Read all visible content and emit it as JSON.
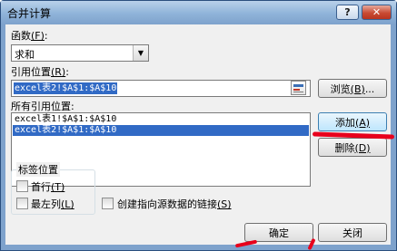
{
  "window": {
    "title": "合并计算",
    "help_glyph": "?",
    "close_glyph": "✕"
  },
  "function": {
    "label": "函数",
    "hotkey": "(F)",
    "suffix": ":",
    "value": "求和"
  },
  "reference": {
    "label": "引用位置",
    "hotkey": "(R)",
    "suffix": ":",
    "value": "excel表2!$A$1:$A$10",
    "browse_label": "浏览",
    "browse_hotkey": "(B)",
    "browse_suffix": "..."
  },
  "all_references": {
    "label": "所有引用位置",
    "suffix": ":",
    "items": [
      "excel表1!$A$1:$A$10",
      "excel表2!$A$1:$A$10"
    ],
    "selected_index": 1
  },
  "buttons": {
    "add_label": "添加",
    "add_hotkey": "(A)",
    "delete_label": "删除",
    "delete_hotkey": "(D)",
    "ok_label": "确定",
    "close_label": "关闭"
  },
  "label_position": {
    "title": "标签位置",
    "top_row_label": "首行",
    "top_row_hotkey": "(T)",
    "left_column_label": "最左列",
    "left_column_hotkey": "(L)"
  },
  "link": {
    "label": "创建指向源数据的链接",
    "hotkey": "(S)"
  },
  "colors": {
    "selection": "#316ac5",
    "annotation": "#e8001c"
  },
  "icons": {
    "ref_picker": "collapse-dialog-icon",
    "dropdown": "chevron-down-icon"
  }
}
